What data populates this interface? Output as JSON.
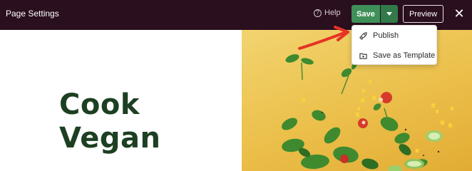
{
  "topbar": {
    "title": "Page Settings",
    "help_label": "Help",
    "save_label": "Save",
    "preview_label": "Preview",
    "close_symbol": "✕"
  },
  "dropdown": {
    "items": [
      {
        "label": "Publish",
        "icon": "rocket-icon"
      },
      {
        "label": "Save as Template",
        "icon": "folder-icon"
      }
    ]
  },
  "page": {
    "heading_line1": "Cook",
    "heading_line2": "Vegan"
  },
  "colors": {
    "topbar_bg": "#2a0f1f",
    "save_green": "#3e9059",
    "heading_green": "#1d3f22",
    "annotation_red": "#e53325",
    "image_yellow": "#ebbf4a"
  }
}
